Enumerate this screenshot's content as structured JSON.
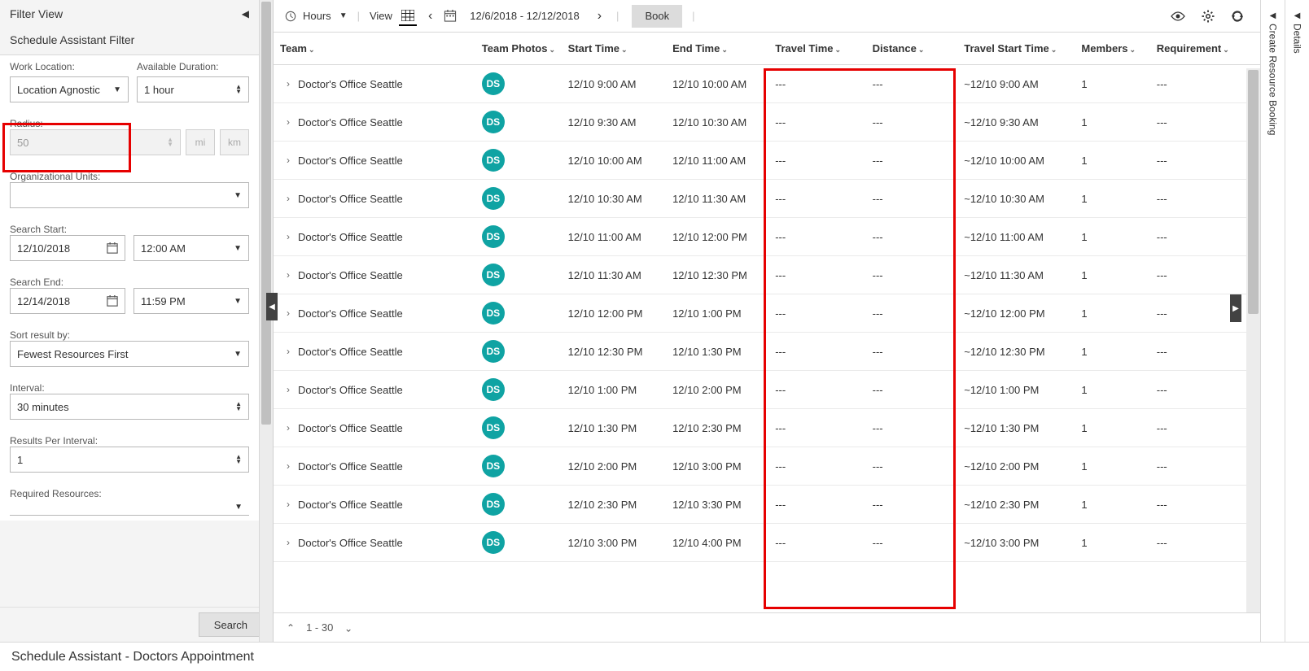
{
  "sidebar": {
    "filter_view_title": "Filter View",
    "schedule_assist_title": "Schedule Assistant Filter",
    "work_location": {
      "label": "Work Location:",
      "value": "Location Agnostic"
    },
    "available_duration": {
      "label": "Available Duration:",
      "value": "1 hour"
    },
    "radius": {
      "label": "Radius:",
      "value": "50",
      "unit_mi": "mi",
      "unit_km": "km"
    },
    "org_units": {
      "label": "Organizational Units:",
      "value": ""
    },
    "search_start": {
      "label": "Search Start:",
      "date": "12/10/2018",
      "time": "12:00 AM"
    },
    "search_end": {
      "label": "Search End:",
      "date": "12/14/2018",
      "time": "11:59 PM"
    },
    "sort": {
      "label": "Sort result by:",
      "value": "Fewest Resources First"
    },
    "interval": {
      "label": "Interval:",
      "value": "30 minutes"
    },
    "results_per_interval": {
      "label": "Results Per Interval:",
      "value": "1"
    },
    "required_resources": {
      "label": "Required Resources:",
      "value": ""
    },
    "search_button": "Search"
  },
  "toolbar": {
    "hours_label": "Hours",
    "view_label": "View",
    "date_range": "12/6/2018 - 12/12/2018",
    "book_label": "Book"
  },
  "columns": {
    "team": "Team",
    "team_photos": "Team Photos",
    "start_time": "Start Time",
    "end_time": "End Time",
    "travel_time": "Travel Time",
    "distance": "Distance",
    "travel_start": "Travel Start Time",
    "members": "Members",
    "requirement": "Requirement"
  },
  "rows": [
    {
      "team": "Doctor's Office Seattle",
      "initials": "DS",
      "start": "12/10 9:00 AM",
      "end": "12/10 10:00 AM",
      "travel": "---",
      "distance": "---",
      "tstart": "~12/10 9:00 AM",
      "members": "1",
      "req": "---"
    },
    {
      "team": "Doctor's Office Seattle",
      "initials": "DS",
      "start": "12/10 9:30 AM",
      "end": "12/10 10:30 AM",
      "travel": "---",
      "distance": "---",
      "tstart": "~12/10 9:30 AM",
      "members": "1",
      "req": "---"
    },
    {
      "team": "Doctor's Office Seattle",
      "initials": "DS",
      "start": "12/10 10:00 AM",
      "end": "12/10 11:00 AM",
      "travel": "---",
      "distance": "---",
      "tstart": "~12/10 10:00 AM",
      "members": "1",
      "req": "---"
    },
    {
      "team": "Doctor's Office Seattle",
      "initials": "DS",
      "start": "12/10 10:30 AM",
      "end": "12/10 11:30 AM",
      "travel": "---",
      "distance": "---",
      "tstart": "~12/10 10:30 AM",
      "members": "1",
      "req": "---"
    },
    {
      "team": "Doctor's Office Seattle",
      "initials": "DS",
      "start": "12/10 11:00 AM",
      "end": "12/10 12:00 PM",
      "travel": "---",
      "distance": "---",
      "tstart": "~12/10 11:00 AM",
      "members": "1",
      "req": "---"
    },
    {
      "team": "Doctor's Office Seattle",
      "initials": "DS",
      "start": "12/10 11:30 AM",
      "end": "12/10 12:30 PM",
      "travel": "---",
      "distance": "---",
      "tstart": "~12/10 11:30 AM",
      "members": "1",
      "req": "---"
    },
    {
      "team": "Doctor's Office Seattle",
      "initials": "DS",
      "start": "12/10 12:00 PM",
      "end": "12/10 1:00 PM",
      "travel": "---",
      "distance": "---",
      "tstart": "~12/10 12:00 PM",
      "members": "1",
      "req": "---"
    },
    {
      "team": "Doctor's Office Seattle",
      "initials": "DS",
      "start": "12/10 12:30 PM",
      "end": "12/10 1:30 PM",
      "travel": "---",
      "distance": "---",
      "tstart": "~12/10 12:30 PM",
      "members": "1",
      "req": "---"
    },
    {
      "team": "Doctor's Office Seattle",
      "initials": "DS",
      "start": "12/10 1:00 PM",
      "end": "12/10 2:00 PM",
      "travel": "---",
      "distance": "---",
      "tstart": "~12/10 1:00 PM",
      "members": "1",
      "req": "---"
    },
    {
      "team": "Doctor's Office Seattle",
      "initials": "DS",
      "start": "12/10 1:30 PM",
      "end": "12/10 2:30 PM",
      "travel": "---",
      "distance": "---",
      "tstart": "~12/10 1:30 PM",
      "members": "1",
      "req": "---"
    },
    {
      "team": "Doctor's Office Seattle",
      "initials": "DS",
      "start": "12/10 2:00 PM",
      "end": "12/10 3:00 PM",
      "travel": "---",
      "distance": "---",
      "tstart": "~12/10 2:00 PM",
      "members": "1",
      "req": "---"
    },
    {
      "team": "Doctor's Office Seattle",
      "initials": "DS",
      "start": "12/10 2:30 PM",
      "end": "12/10 3:30 PM",
      "travel": "---",
      "distance": "---",
      "tstart": "~12/10 2:30 PM",
      "members": "1",
      "req": "---"
    },
    {
      "team": "Doctor's Office Seattle",
      "initials": "DS",
      "start": "12/10 3:00 PM",
      "end": "12/10 4:00 PM",
      "travel": "---",
      "distance": "---",
      "tstart": "~12/10 3:00 PM",
      "members": "1",
      "req": "---"
    }
  ],
  "pager": {
    "range": "1 - 30"
  },
  "right_tabs": {
    "details": "Details",
    "create_booking": "Create Resource Booking"
  },
  "footer": {
    "title": "Schedule Assistant - Doctors Appointment"
  },
  "colors": {
    "avatar_bg": "#0fa3a3",
    "highlight": "#e60000"
  }
}
